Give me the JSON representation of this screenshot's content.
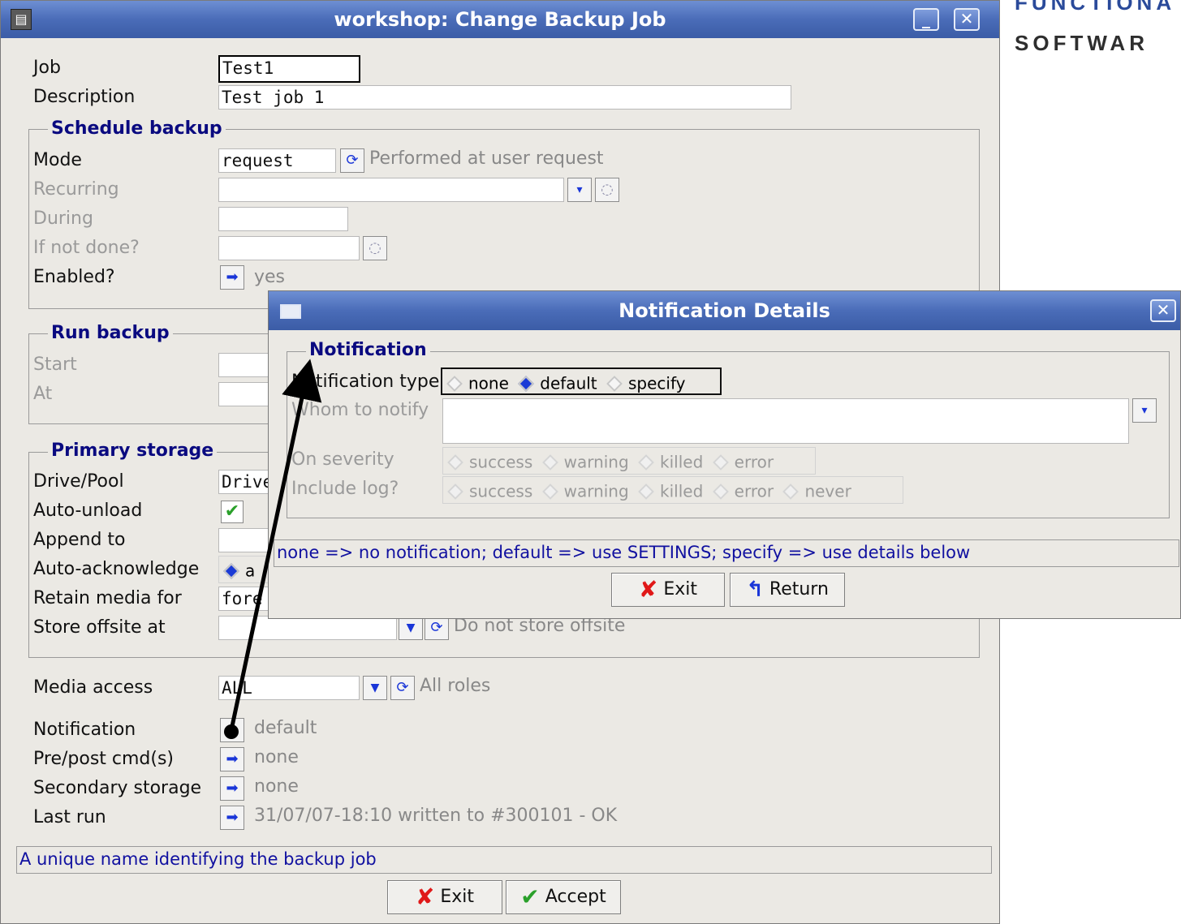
{
  "brand": {
    "line1": "FUNCTIONA",
    "line2": "SOFTWAR"
  },
  "main_window": {
    "title": "workshop: Change Backup Job",
    "fields": {
      "job_label": "Job",
      "job_value": "Test1",
      "description_label": "Description",
      "description_value": "Test job 1"
    },
    "schedule": {
      "group_label": "Schedule backup",
      "mode_label": "Mode",
      "mode_value": "request",
      "mode_desc": "Performed at user request",
      "recurring_label": "Recurring",
      "during_label": "During",
      "if_not_done_label": "If not done?",
      "enabled_label": "Enabled?",
      "enabled_value": "yes"
    },
    "run": {
      "group_label": "Run backup",
      "start_label": "Start",
      "at_label": "At"
    },
    "primary": {
      "group_label": "Primary storage",
      "drive_label": "Drive/Pool",
      "drive_value": "Drive",
      "auto_unload_label": "Auto-unload",
      "append_label": "Append to",
      "auto_ack_label": "Auto-acknowledge",
      "auto_ack_value": "a",
      "retain_label": "Retain media for",
      "retain_value": "fore",
      "offsite_label": "Store offsite at",
      "offsite_desc": "Do not store offsite"
    },
    "media_access": {
      "label": "Media access",
      "value": "ALL",
      "desc": "All roles"
    },
    "notification": {
      "label": "Notification",
      "value": "default"
    },
    "prepost": {
      "label": "Pre/post cmd(s)",
      "value": "none"
    },
    "secondary": {
      "label": "Secondary storage",
      "value": "none"
    },
    "last_run": {
      "label": "Last run",
      "value": "31/07/07-18:10 written to #300101 - OK"
    },
    "status": "A unique name identifying the backup job",
    "buttons": {
      "exit": "Exit",
      "accept": "Accept"
    }
  },
  "dialog": {
    "title": "Notification Details",
    "group_label": "Notification",
    "type_label": "Notification type",
    "type_options": [
      "none",
      "default",
      "specify"
    ],
    "type_selected": "default",
    "whom_label": "Whom to notify",
    "severity_label": "On severity",
    "severity_options": [
      "success",
      "warning",
      "killed",
      "error"
    ],
    "log_label": "Include log?",
    "log_options": [
      "success",
      "warning",
      "killed",
      "error",
      "never"
    ],
    "status": "none => no notification; default => use SETTINGS; specify => use details below",
    "buttons": {
      "exit": "Exit",
      "return": "Return"
    }
  }
}
